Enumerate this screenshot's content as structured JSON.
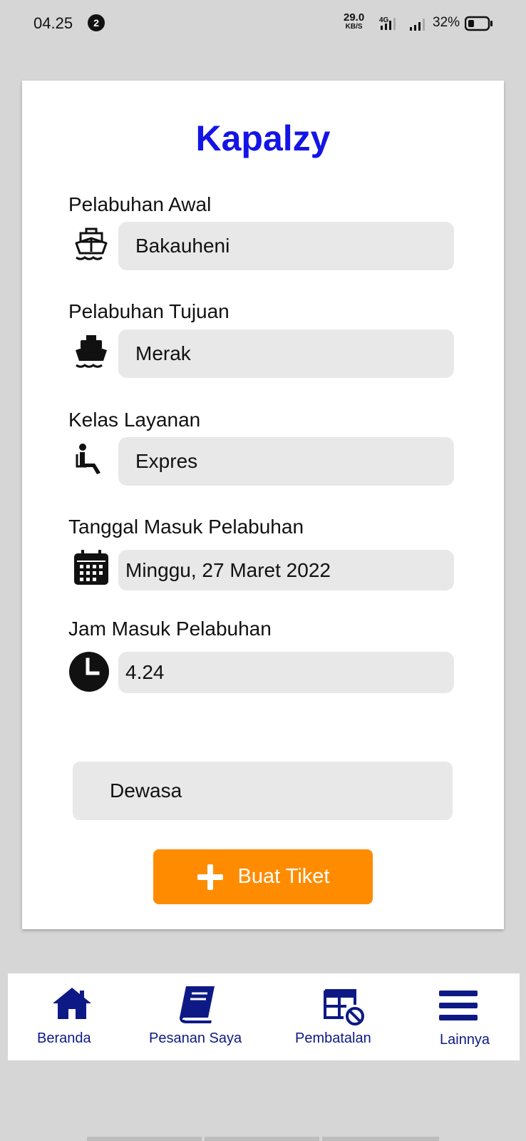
{
  "status_bar": {
    "time": "04.25",
    "notification_count": "2",
    "speed_value": "29.0",
    "speed_unit": "KB/S",
    "network": "4G",
    "battery_percent": "32%",
    "battery_level": 0.32
  },
  "app": {
    "title": "Kapalzy",
    "title_color": "#1414e6"
  },
  "form": {
    "departure": {
      "label": "Pelabuhan Awal",
      "value": "Bakauheni",
      "icon": "ship-outline-icon"
    },
    "destination": {
      "label": "Pelabuhan Tujuan",
      "value": "Merak",
      "icon": "ship-filled-icon"
    },
    "service_class": {
      "label": "Kelas Layanan",
      "value": "Expres",
      "icon": "seat-icon"
    },
    "date": {
      "label": "Tanggal Masuk Pelabuhan",
      "value": "Minggu, 27 Maret 2022",
      "icon": "calendar-icon"
    },
    "time": {
      "label": "Jam Masuk Pelabuhan",
      "value": "4.24",
      "icon": "clock-icon"
    },
    "passenger_type": {
      "value": "Dewasa"
    }
  },
  "create_button": {
    "label": "Buat Tiket",
    "icon": "plus-icon",
    "color": "#ff8c00"
  },
  "bottom_nav": {
    "color": "#0d1a85",
    "items": [
      {
        "label": "Beranda",
        "icon": "home-icon"
      },
      {
        "label": "Pesanan Saya",
        "icon": "book-icon"
      },
      {
        "label": "Pembatalan",
        "icon": "cancel-table-icon"
      },
      {
        "label": "Lainnya",
        "icon": "menu-icon"
      }
    ]
  }
}
